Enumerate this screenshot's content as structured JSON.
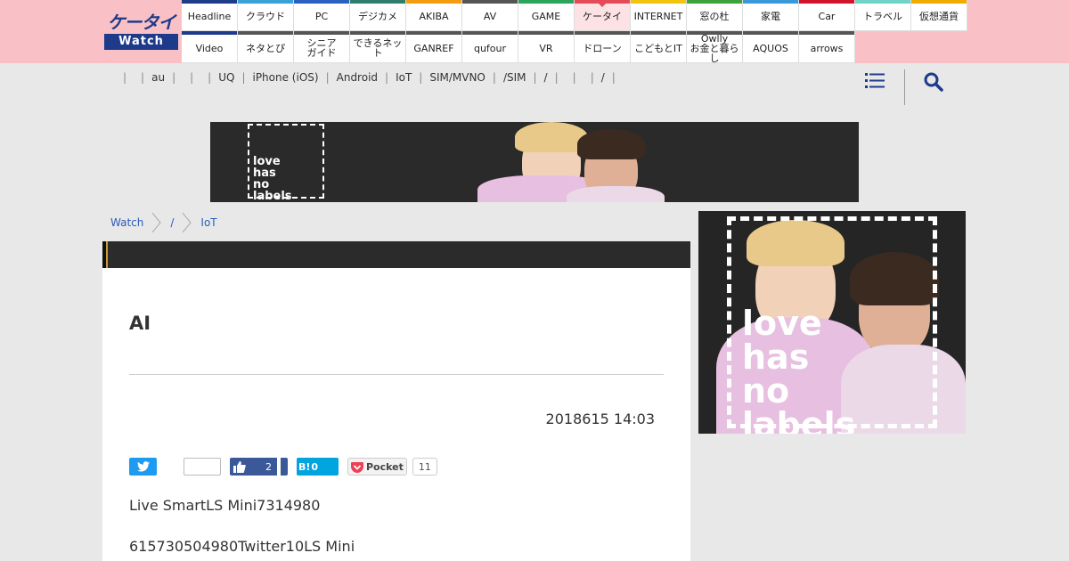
{
  "logo": {
    "top": "ケータイ",
    "bottom": "Watch"
  },
  "nav_top": [
    {
      "label": "Headline",
      "color": "#1e3a8a"
    },
    {
      "label": "クラウド",
      "color": "#3aa0d8"
    },
    {
      "label": "PC",
      "color": "#2a60c0"
    },
    {
      "label": "デジカメ",
      "color": "#2e7d6e"
    },
    {
      "label": "AKIBA",
      "color": "#f39c12"
    },
    {
      "label": "AV",
      "color": "#555555"
    },
    {
      "label": "GAME",
      "color": "#2aa35b"
    },
    {
      "label": "ケータイ",
      "color": "#e44a5a",
      "active": true
    },
    {
      "label": "INTERNET",
      "color": "#f1c40f"
    },
    {
      "label": "窓の杜",
      "color": "#3ea23a"
    },
    {
      "label": "家電",
      "color": "#3a9ad9"
    },
    {
      "label": "Car",
      "color": "#d0142c"
    },
    {
      "label": "トラベル",
      "color": "#6fd3c8"
    },
    {
      "label": "仮想通貨",
      "color": "#f2a900"
    }
  ],
  "nav_bottom": [
    {
      "label": "Video",
      "color": "#1e3a8a"
    },
    {
      "label": "ネタとぴ",
      "color": "#555555"
    },
    {
      "label": "シニア\nガイド",
      "color": "#555555"
    },
    {
      "label": "できるネット",
      "color": "#555555"
    },
    {
      "label": "GANREF",
      "color": "#555555"
    },
    {
      "label": "qufour",
      "color": "#555555"
    },
    {
      "label": "VR",
      "color": "#555555"
    },
    {
      "label": "ドローン",
      "color": "#555555"
    },
    {
      "label": "こどもとIT",
      "color": "#555555"
    },
    {
      "label": "Owlly\nお金と暮らし",
      "color": "#555555"
    },
    {
      "label": "AQUOS",
      "color": "#555555"
    },
    {
      "label": "arrows",
      "color": "#555555"
    }
  ],
  "subnav": {
    "items": [
      "",
      "au",
      "",
      "",
      "UQ",
      "iPhone (iOS)",
      "Android",
      "IoT",
      "SIM/MVNO",
      "/SIM",
      "/",
      "",
      "",
      "/",
      ""
    ]
  },
  "icons": {
    "menu": "menu-icon",
    "search": "search-icon"
  },
  "ads": {
    "top_text": "love\nhas\nno\nlabels",
    "side_text": "love\nhas\nno\nlabels"
  },
  "breadcrumb": [
    "Watch",
    "/",
    "IoT"
  ],
  "article": {
    "title": "AI",
    "date": "2018615 14:03",
    "social": {
      "facebook_count": "2",
      "hatena_label": "B!",
      "hatena_count": "0",
      "pocket_label": "Pocket",
      "pocket_count": "11"
    },
    "paragraphs": [
      "Live SmartLS Mini7314980",
      "615730504980Twitter10LS Mini"
    ]
  },
  "colors": {
    "header_bg": "#f9c1c5",
    "brand": "#1e3a8a",
    "link": "#2d5bb8"
  }
}
